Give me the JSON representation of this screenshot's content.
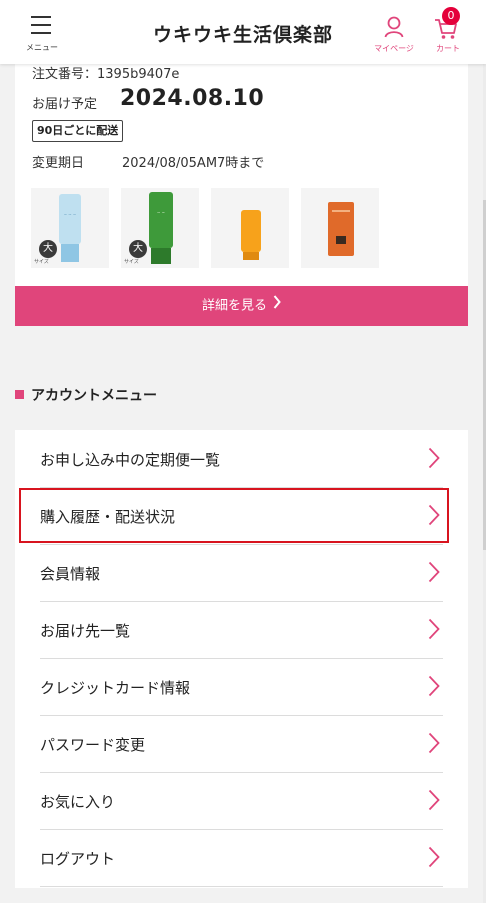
{
  "header": {
    "menu_label": "メニュー",
    "logo": "ウキウキ生活倶楽部",
    "mypage_label": "マイページ",
    "cart_label": "カート",
    "cart_count": "0",
    "accent_color": "#e0457b"
  },
  "order": {
    "order_no": "注文番号：1395b9407e",
    "delivery_label": "お届け予定",
    "delivery_date": "2024.08.10",
    "frequency": "90日ごとに配送",
    "change_label": "変更期日",
    "change_deadline": "2024/08/05AM7時まで",
    "size_badge": "大",
    "size_sub": "サイズ",
    "products": [
      {
        "name": "light-blue-tube",
        "size_badge": true
      },
      {
        "name": "green-tube",
        "size_badge": true
      },
      {
        "name": "orange-tube",
        "size_badge": false
      },
      {
        "name": "orange-box",
        "size_badge": false
      }
    ],
    "detail_button": "詳細を見る"
  },
  "account_menu": {
    "title": "アカウントメニュー",
    "items": [
      {
        "label": "お申し込み中の定期便一覧"
      },
      {
        "label": "購入履歴・配送状況",
        "highlighted": true
      },
      {
        "label": "会員情報"
      },
      {
        "label": "お届け先一覧"
      },
      {
        "label": "クレジットカード情報"
      },
      {
        "label": "パスワード変更"
      },
      {
        "label": "お気に入り"
      },
      {
        "label": "ログアウト"
      }
    ]
  }
}
